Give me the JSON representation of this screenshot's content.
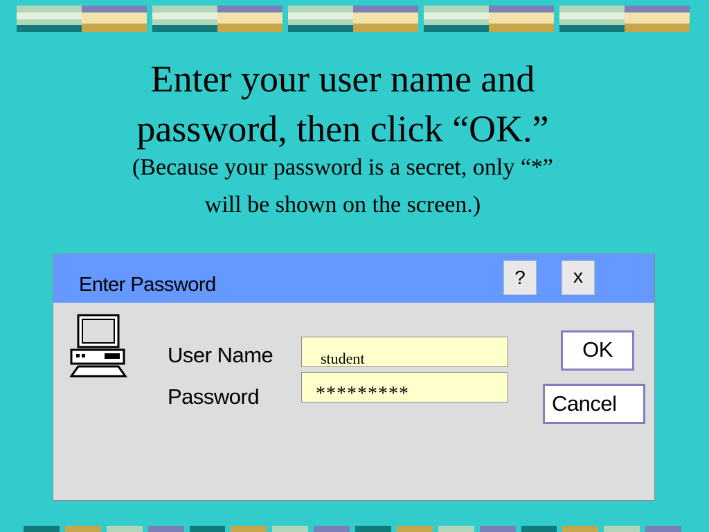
{
  "instructions": {
    "line1": "Enter your user name and",
    "line2": "password, then click “OK.”",
    "line3": "(Because your password is a secret, only “*”",
    "line4": "will be shown on the screen.)"
  },
  "dialog": {
    "title": "Enter Password",
    "help_label": "?",
    "close_label": "x",
    "username_label": "User Name",
    "username_value": "student",
    "password_label": "Password",
    "password_value": "*********",
    "ok_label": "OK",
    "cancel_label": "Cancel"
  },
  "colors": {
    "background": "#33cccc",
    "titlebar": "#6699ff",
    "dialog_body": "#dddddd",
    "field_bg": "#ffffcc",
    "button_border": "#8080c0"
  },
  "icons": {
    "computer": "computer-icon"
  }
}
